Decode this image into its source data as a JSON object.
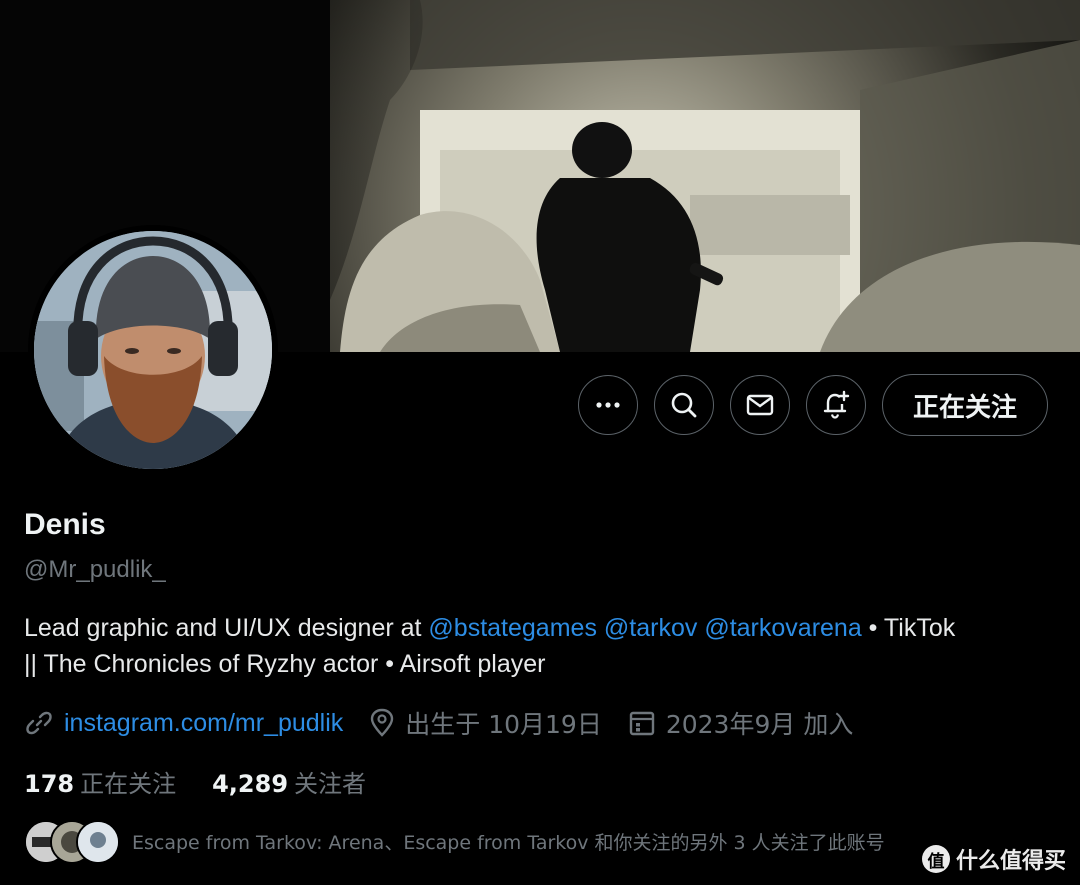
{
  "profile": {
    "display_name": "Denis",
    "handle": "@Mr_pudlik_"
  },
  "actions": {
    "more_icon": "more-icon",
    "search_icon": "search-icon",
    "message_icon": "mail-icon",
    "notify_icon": "bell-plus-icon",
    "follow_label": "正在关注"
  },
  "bio": {
    "text_1": "Lead graphic and UI/UX designer at ",
    "mention_1": "@bstategames",
    "space_1": " ",
    "mention_2": "@tarkov",
    "space_2": " ",
    "mention_3": "@tarkovarena",
    "text_2": " • TikTok",
    "line_2": "|| The Chronicles of Ryzhy actor • Airsoft player"
  },
  "meta": {
    "link": "instagram.com/mr_pudlik",
    "birthday": "出生于 10月19日",
    "joined": "2023年9月 加入"
  },
  "counts": {
    "following_num": "178",
    "following_label": "正在关注",
    "followers_num": "4,289",
    "followers_label": "关注者"
  },
  "followed_by": {
    "text": "Escape from Tarkov: Arena、Escape from Tarkov 和你关注的另外 3 人关注了此账号"
  },
  "watermark": {
    "badge": "值",
    "text": "什么值得买"
  },
  "colors": {
    "background": "#000000",
    "primary_text": "#e7e9ea",
    "secondary_text": "#6f767c",
    "link": "#2d8de4",
    "button_border": "#5b6268"
  }
}
